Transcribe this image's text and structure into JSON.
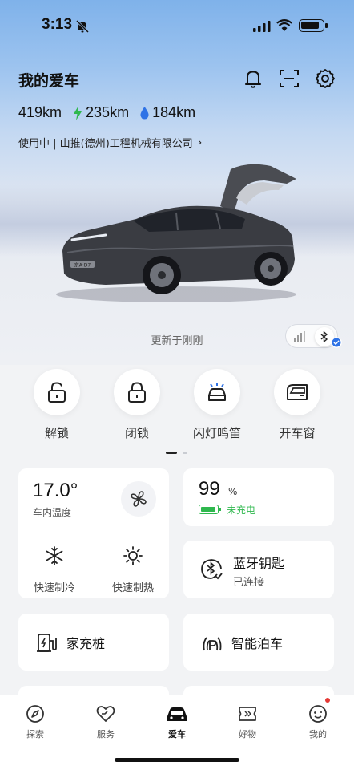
{
  "status_bar": {
    "time": "3:13"
  },
  "header": {
    "title": "我的爱车",
    "ranges": [
      {
        "icon": "",
        "value": "419km",
        "color": "#111111"
      },
      {
        "icon": "lightning-icon",
        "value": "235km",
        "color": "#2fb84e"
      },
      {
        "icon": "fuel-drop-icon",
        "value": "184km",
        "color": "#2f73e6"
      }
    ],
    "usage_text": "使用中 | 山推(德州)工程机械有限公司",
    "usage_chevron": "›"
  },
  "vehicle": {
    "updated_text": "更新于刚刚",
    "plate_text": "京A·D7"
  },
  "quick_actions": [
    {
      "label": "解锁",
      "icon": "unlock-icon"
    },
    {
      "label": "闭锁",
      "icon": "lock-icon"
    },
    {
      "label": "闪灯鸣笛",
      "icon": "flash-horn-icon"
    },
    {
      "label": "开车窗",
      "icon": "window-icon"
    }
  ],
  "climate": {
    "temperature": "17.0°",
    "temperature_label": "车内温度",
    "cool_label": "快速制冷",
    "heat_label": "快速制热"
  },
  "battery": {
    "percent": "99",
    "unit": "%",
    "status": "未充电",
    "level": 0.99,
    "color": "#2fb84e"
  },
  "bluetooth_key": {
    "title": "蓝牙钥匙",
    "status": "已连接"
  },
  "cards": {
    "home_charger": "家充桩",
    "smart_parking": "智能泊车"
  },
  "tabbar": [
    {
      "label": "探索",
      "icon": "compass-icon",
      "active": false
    },
    {
      "label": "服务",
      "icon": "service-heart-icon",
      "active": false
    },
    {
      "label": "爱车",
      "icon": "car-icon",
      "active": true
    },
    {
      "label": "好物",
      "icon": "ticket-icon",
      "active": false
    },
    {
      "label": "我的",
      "icon": "profile-icon",
      "active": false
    }
  ],
  "colors": {
    "accent_blue": "#2f73e6",
    "green": "#2fb84e",
    "notification_red": "#e53935"
  }
}
